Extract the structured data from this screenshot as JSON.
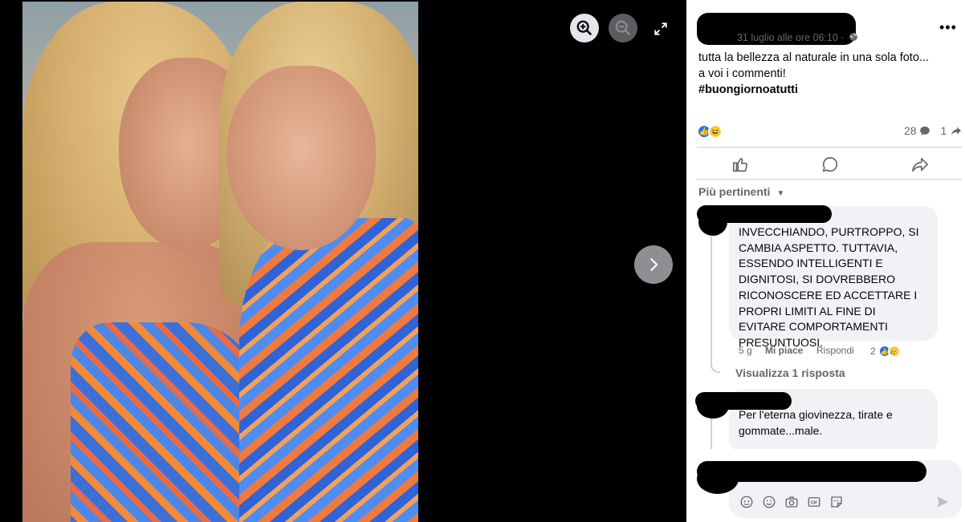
{
  "post": {
    "date": "31 luglio alle ore 06:10 ·",
    "text_line1": "tutta la bellezza al naturale in una sola foto...",
    "text_line2": "a voi i commenti!",
    "hashtag": "#buongiornoatutti",
    "comment_count": "28",
    "share_count": "1"
  },
  "sort_label": "Più pertinenti",
  "comments": [
    {
      "text": "INVECCHIANDO, PURTROPPO, SI CAMBIA ASPETTO. TUTTAVIA, ESSENDO INTELLIGENTI E DIGNITOSI, SI DOVREBBERO RICONOSCERE ED ACCETTARE I PROPRI LIMITI AL FINE DI EVITARE COMPORTAMENTI PRESUNTUOSI.",
      "time": "5 g",
      "like_label": "Mi piace",
      "reply_label": "Rispondi",
      "reaction_count": "2"
    },
    {
      "text": "Per l'eterna giovinezza, tirate e gommate...male."
    }
  ],
  "view_replies": "Visualizza 1 risposta",
  "icons": [
    "zoom-in-icon",
    "zoom-out-icon",
    "expand-icon",
    "chevron-right-icon",
    "globe-icon",
    "more-icon",
    "like-icon",
    "comment-icon",
    "share-icon",
    "avatar-sticker-icon",
    "emoji-icon",
    "camera-icon",
    "gif-icon",
    "sticker-icon",
    "send-icon"
  ],
  "colors": {
    "accent": "#1877f2",
    "panel_bg": "#ffffff",
    "bubble_bg": "#f0f2f5",
    "secondary_text": "#65676b"
  }
}
